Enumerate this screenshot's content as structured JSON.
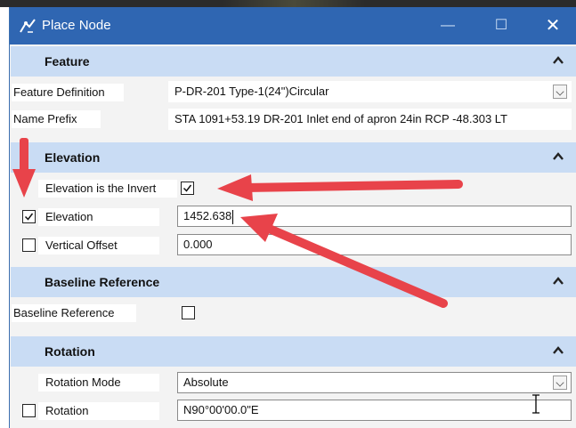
{
  "window": {
    "title": "Place Node",
    "minimize": "—",
    "maximize": "☐",
    "close": "✕"
  },
  "panels": {
    "feature": {
      "title": "Feature",
      "feature_definition": {
        "label": "Feature Definition",
        "value": "P-DR-201 Type-1(24\")Circular"
      },
      "name_prefix": {
        "label": "Name Prefix",
        "value": "STA 1091+53.19 DR-201 Inlet end of apron 24in RCP -48.303 LT"
      }
    },
    "elevation": {
      "title": "Elevation",
      "elevation_is_invert": {
        "label": "Elevation is the Invert",
        "checked": true
      },
      "elevation": {
        "label": "Elevation",
        "checked": true,
        "value": "1452.638"
      },
      "vertical_offset": {
        "label": "Vertical Offset",
        "checked": false,
        "value": "0.000"
      }
    },
    "baseline": {
      "title": "Baseline Reference",
      "baseline_reference": {
        "label": "Baseline Reference",
        "checked": false
      }
    },
    "rotation": {
      "title": "Rotation",
      "rotation_mode": {
        "label": "Rotation Mode",
        "value": "Absolute"
      },
      "rotation": {
        "label": "Rotation",
        "checked": false,
        "value": "N90°00'00.0\"E"
      }
    }
  },
  "colors": {
    "titlebar": "#2f66b2",
    "panel_header": "#c9dcf4",
    "annotation_arrow": "#e8434a"
  }
}
